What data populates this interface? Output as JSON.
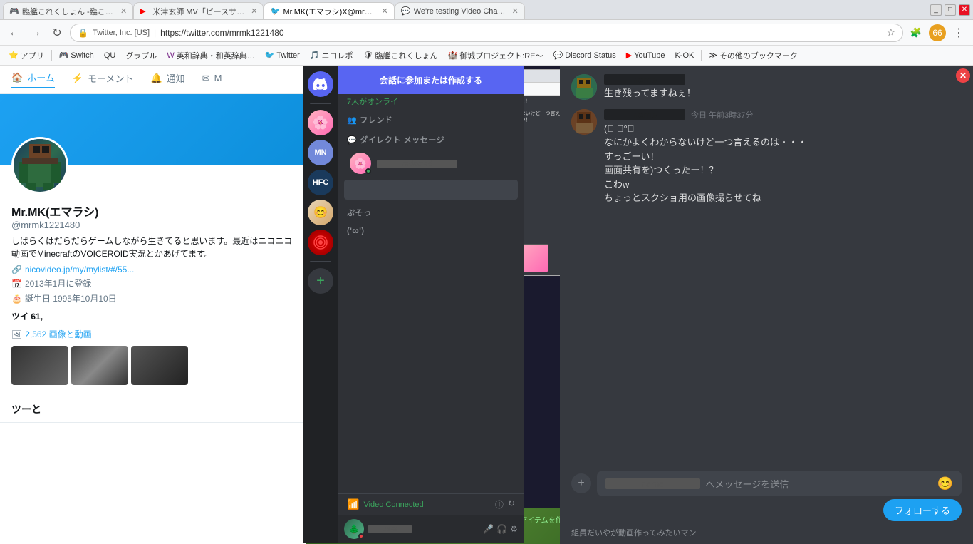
{
  "browser": {
    "tabs": [
      {
        "id": "tab1",
        "favicon": "🎮",
        "title": "臨艦これくしょん -臨これ-",
        "active": false
      },
      {
        "id": "tab2",
        "favicon": "▶",
        "title": "米津玄師 MV「ピースサイン」",
        "active": false
      },
      {
        "id": "tab3",
        "favicon": "🐦",
        "title": "Mr.MK(エマラシ)X@mrmk122...",
        "active": true
      },
      {
        "id": "tab4",
        "favicon": "💬",
        "title": "We're testing Video Chat...",
        "active": false
      }
    ],
    "window_controls": [
      "_",
      "□",
      "✕"
    ],
    "address": {
      "lock": "🔒",
      "company": "Twitter, Inc. [US]",
      "separator": "|",
      "url": "https://twitter.com/mrmk1221480"
    },
    "bookmarks": [
      {
        "icon": "⭐",
        "label": "アプリ"
      },
      {
        "icon": "🎮",
        "label": "Switch"
      },
      {
        "icon": "Q",
        "label": "QU"
      },
      {
        "icon": "🌐",
        "label": "グラプル"
      },
      {
        "icon": "W",
        "label": "英和辞典・和英辞典…"
      },
      {
        "icon": "🐦",
        "label": "Twitter",
        "color": "twitter-blue"
      },
      {
        "icon": "🎵",
        "label": "ニコレポ"
      },
      {
        "icon": "🛡",
        "label": "臨艦これくしょん"
      },
      {
        "icon": "🏰",
        "label": "御城プロジェクト:RE～"
      },
      {
        "icon": "💬",
        "label": "Discord Status"
      },
      {
        "icon": "▶",
        "label": "YouTube",
        "color": "youtube-red"
      },
      {
        "icon": "✓",
        "label": "K-OK"
      },
      {
        "icon": "▸",
        "label": "その他のブックマーク"
      }
    ]
  },
  "twitter": {
    "nav_items": [
      {
        "label": "🏠 ホーム",
        "active": true
      },
      {
        "label": "⚡ モーメント",
        "active": false
      },
      {
        "label": "🔔 通知",
        "active": false
      },
      {
        "label": "✉ M",
        "active": false
      }
    ],
    "profile": {
      "name": "Mr.MK(エマラシ)",
      "handle": "@mrmk1221480",
      "bio": "しばらくはだらだらゲームしながら生きてると思います。最近はニコニコ動画でMinecraftのVOICEROID実況とかあげてます。",
      "website": "nicovideo.jp/my/mylist/#/55...",
      "joined": "2013年1月に登録",
      "birthday": "誕生日 1995年10月10日",
      "tweets_label": "ツイ",
      "tweets_count": "61,",
      "media_count": "2,562 画像と動画"
    },
    "tweets_section": "ツーと"
  },
  "discord": {
    "join_button": "会話に参加または作成する",
    "online_count": "7人がオンライ",
    "friends_label": "フレンド",
    "dm_label": "ダイレクト メッセージ",
    "users": [
      {
        "initials": "MN",
        "color": "#7289da"
      },
      {
        "initials": "HFC",
        "color": "#1a3a5c"
      },
      {
        "icon": "face",
        "color": "#f0c040"
      },
      {
        "icon": "red",
        "color": "#cc0000"
      },
      {
        "initials": "snake",
        "color": "#1a1a1a"
      }
    ],
    "dm_placeholder": "",
    "video_connected": "Video Connected",
    "buzso_label": "ぷそっ",
    "snake_label": "('ω')",
    "add_server": "+",
    "user_controls": {
      "mute": "🎤",
      "deafen": "🎧",
      "settings": "⚙"
    }
  },
  "chat": {
    "close": "✕",
    "messages": [
      {
        "avatar_color": "green",
        "name": "REDACTED",
        "time": "",
        "text": "生き残ってますねぇ！"
      },
      {
        "avatar_color": "brown",
        "name": "REDACTED",
        "time": "今日 午前3時37分",
        "lines": [
          "(ﾟ  ﾟ°）",
          "なにかよくわからないけど一つ言えるのは・・・",
          "すっごーい！",
          "画面共有を)つくったー！？",
          "こわw",
          "ちょっとスクショ用の画像撮らせてね"
        ]
      }
    ],
    "input_placeholder": "へメッセージを送信",
    "emoji_button": "😊"
  }
}
